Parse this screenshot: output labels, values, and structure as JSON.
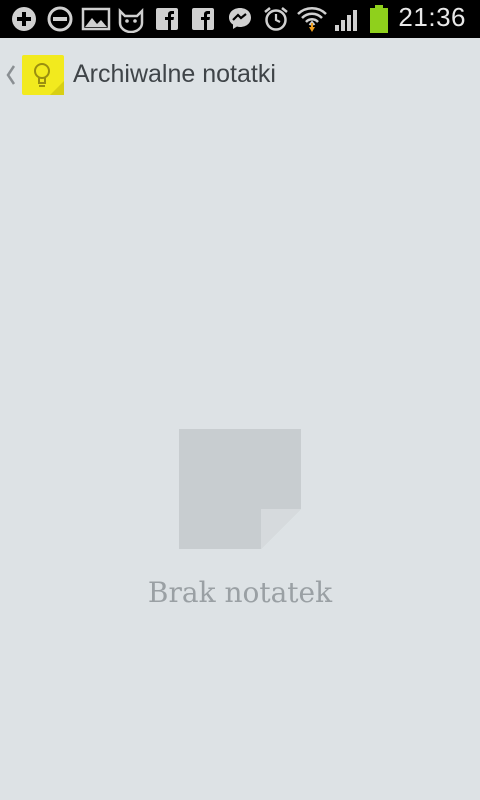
{
  "status_bar": {
    "time": "21:36",
    "icons": [
      "add-circle-icon",
      "minus-circle-icon",
      "image-icon",
      "cat-icon",
      "facebook-icon",
      "facebook-icon",
      "messenger-icon",
      "alarm-icon",
      "wifi-icon",
      "signal-icon",
      "battery-icon"
    ],
    "battery_color": "#8fd01c"
  },
  "action_bar": {
    "title": "Archiwalne notatki",
    "app_icon_color": "#f2ea1e"
  },
  "empty_state": {
    "message": "Brak notatek",
    "illustration_color": "#c8cdd0"
  }
}
